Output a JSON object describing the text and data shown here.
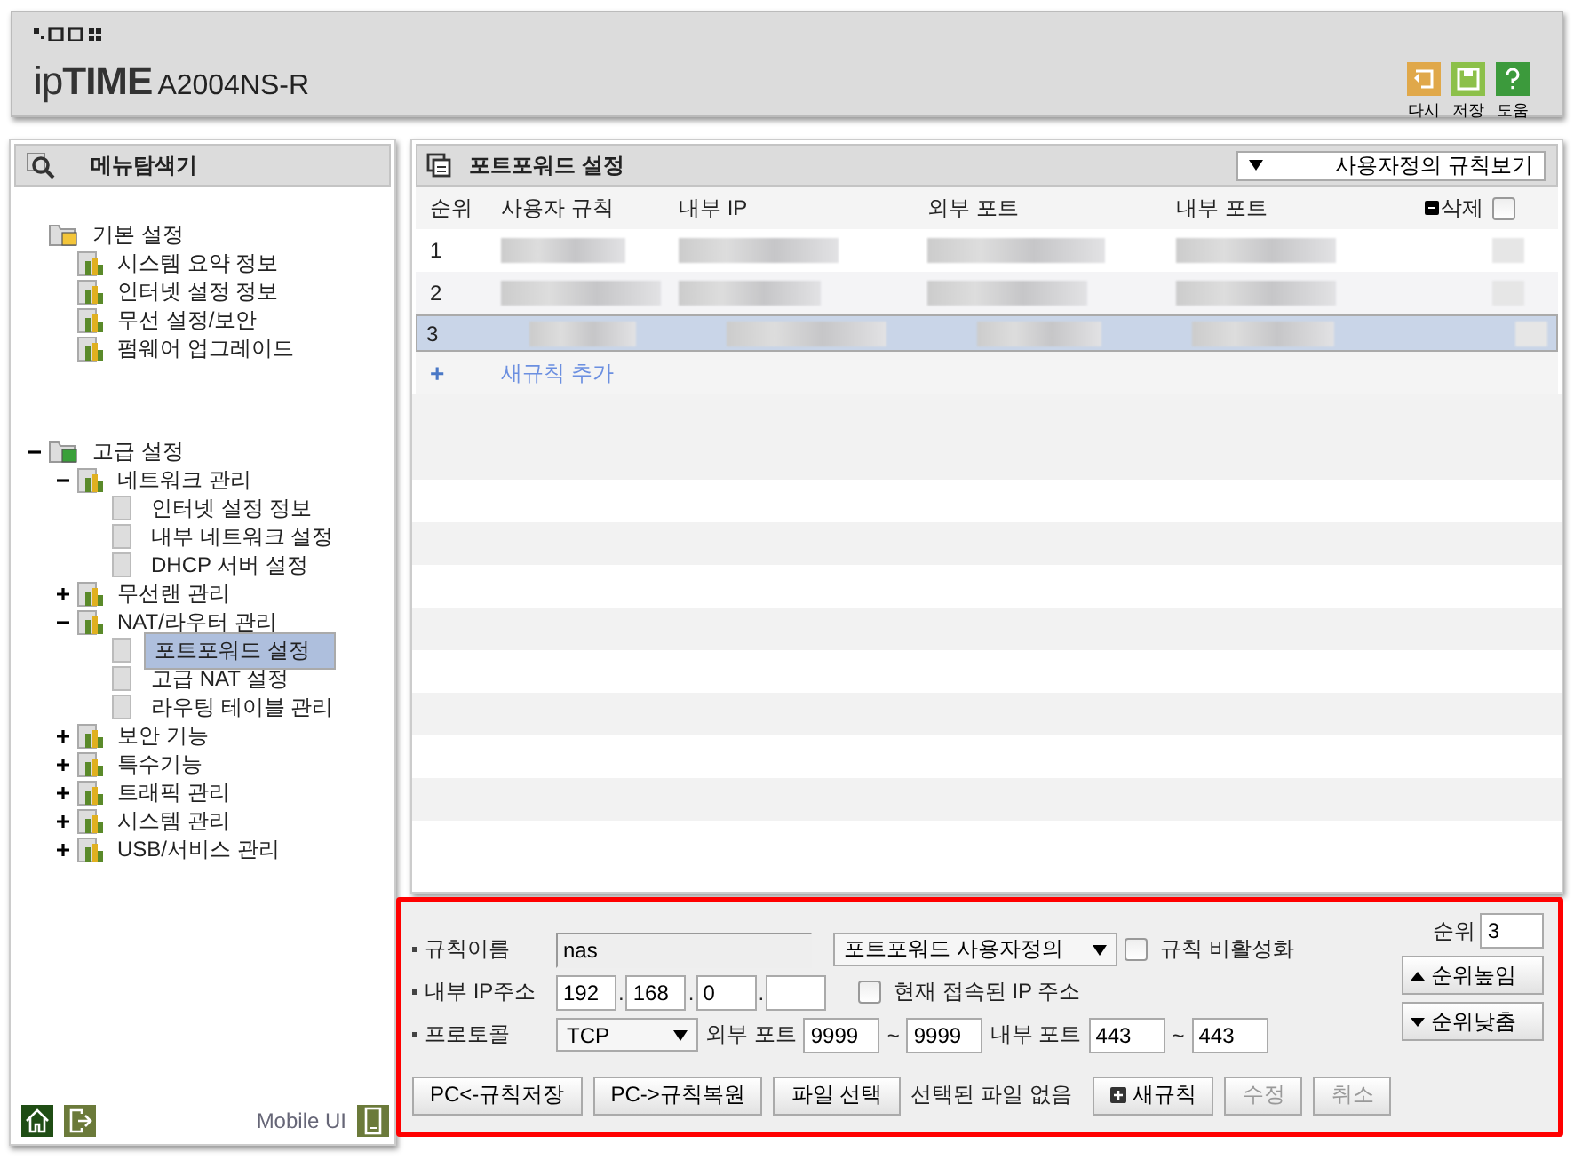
{
  "header": {
    "logo": "ip**TIME**",
    "model": "A2004NS-R",
    "actions": [
      {
        "label": "다시"
      },
      {
        "label": "저장"
      },
      {
        "label": "도움"
      }
    ]
  },
  "sidebar": {
    "title": "메뉴탐색기",
    "tree": [
      {
        "label": "기본 설정",
        "children": [
          {
            "label": "시스템 요약 정보"
          },
          {
            "label": "인터넷 설정 정보"
          },
          {
            "label": "무선 설정/보안"
          },
          {
            "label": "펌웨어 업그레이드"
          }
        ]
      },
      {
        "label": "고급 설정",
        "expanded": true,
        "children": [
          {
            "label": "네트워크 관리",
            "expanded": true,
            "children": [
              {
                "label": "인터넷 설정 정보",
                "selected": false
              },
              {
                "label": "내부 네트워크 설정",
                "selected": false
              },
              {
                "label": "DHCP 서버 설정",
                "selected": false
              }
            ]
          },
          {
            "label": "무선랜 관리",
            "expanded": false
          },
          {
            "label": "NAT/라우터 관리",
            "expanded": true,
            "children": [
              {
                "label": "포트포워드 설정",
                "selected": true
              },
              {
                "label": "고급 NAT 설정",
                "selected": false
              },
              {
                "label": "라우팅 테이블 관리",
                "selected": false
              }
            ]
          },
          {
            "label": "보안 기능",
            "expanded": false
          },
          {
            "label": "특수기능",
            "expanded": false
          },
          {
            "label": "트래픽 관리",
            "expanded": false
          },
          {
            "label": "시스템 관리",
            "expanded": false
          },
          {
            "label": "USB/서비스 관리",
            "expanded": false
          }
        ]
      }
    ],
    "mobile_label": "Mobile UI"
  },
  "main": {
    "title": "포트포워드 설정",
    "view_select": "사용자정의 규칙보기",
    "columns": [
      "순위",
      "사용자 규칙",
      "내부 IP",
      "외부 포트",
      "내부 포트",
      "삭제"
    ],
    "select_all_checked": false,
    "rows": [
      {
        "number": "1",
        "selected": false
      },
      {
        "number": "2",
        "selected": false
      },
      {
        "number": "3",
        "selected": true
      }
    ],
    "add_icon": "+",
    "add_label": "새규칙 추가"
  },
  "form": {
    "rule_name_label": "규칙이름",
    "rule_name": "nas",
    "type_select": "포트포워드 사용자정의",
    "disable": {
      "label": "규칙 비활성화",
      "checked": false
    },
    "ip_label": "내부 IP주소",
    "ip": [
      "192",
      "168",
      "0"
    ],
    "ip_sep": ".",
    "current_ip": {
      "label": "현재 접속된 IP 주소",
      "checked": false
    },
    "protocol_label": "프로토콜",
    "protocol": "TCP",
    "ext_label": "외부 포트",
    "ext_from": "9999",
    "ext_to": "9999",
    "range_sep": "~",
    "int_label": "내부 포트",
    "int_from": "443",
    "int_to": "443",
    "order_label": "순위",
    "order": "3",
    "order_up": "순위높임",
    "order_down": "순위낮춤",
    "save_pc": "PC<-규칙저장",
    "restore_pc": "PC->규칙복원",
    "file_button": "파일 선택",
    "file_status": "선택된 파일 없음",
    "new_rule": "새규칙",
    "edit": {
      "label": "수정",
      "disabled": true
    },
    "cancel": {
      "label": "취소",
      "disabled": true
    }
  }
}
